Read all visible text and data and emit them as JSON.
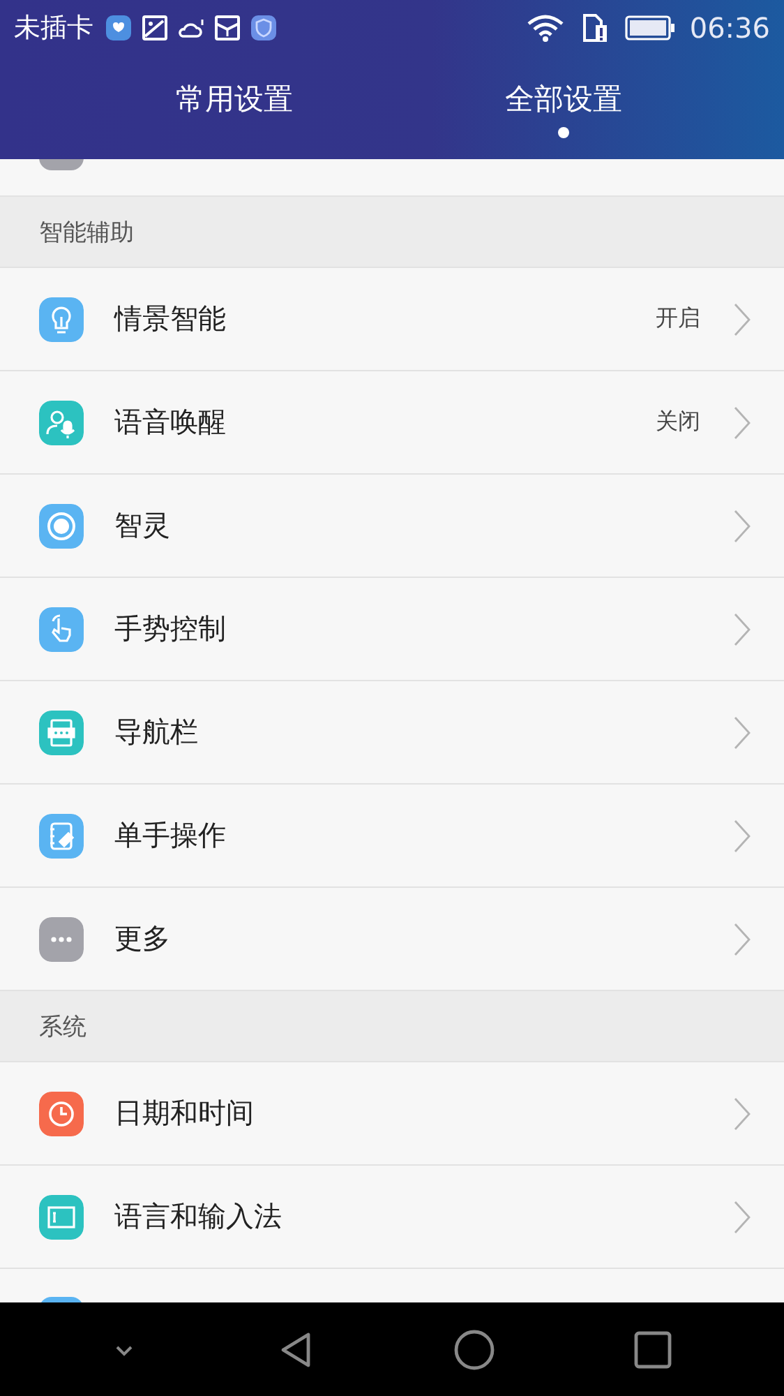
{
  "status_bar": {
    "carrier": "未插卡",
    "time": "06:36"
  },
  "tabs": [
    {
      "label": "常用设置",
      "selected": false
    },
    {
      "label": "全部设置",
      "selected": true
    }
  ],
  "clipped_top": {
    "color": "#a3a3aa"
  },
  "sections": [
    {
      "title": "智能辅助",
      "items": [
        {
          "label": "情景智能",
          "value": "开启",
          "color": "#5ab4f2"
        },
        {
          "label": "语音唤醒",
          "value": "关闭",
          "color": "#2cc2c0"
        },
        {
          "label": "智灵",
          "color": "#5ab4f2"
        },
        {
          "label": "手势控制",
          "color": "#5ab4f2"
        },
        {
          "label": "导航栏",
          "color": "#2cc2c0"
        },
        {
          "label": "单手操作",
          "color": "#5ab4f2"
        },
        {
          "label": "更多",
          "color": "#a3a3aa"
        }
      ]
    },
    {
      "title": "系统",
      "items": [
        {
          "label": "日期和时间",
          "color": "#f66a4c"
        },
        {
          "label": "语言和输入法",
          "color": "#2cc2c0"
        }
      ]
    }
  ],
  "clipped_bottom": {
    "color": "#5ab4f2"
  }
}
